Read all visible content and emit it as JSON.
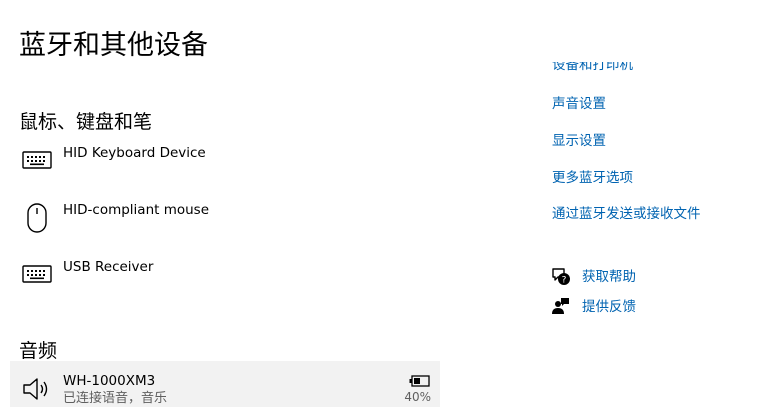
{
  "page": {
    "title": "蓝牙和其他设备"
  },
  "sections": {
    "input": {
      "title": "鼠标、键盘和笔",
      "devices": [
        {
          "name": "HID Keyboard Device",
          "icon": "keyboard-icon"
        },
        {
          "name": "HID-compliant mouse",
          "icon": "mouse-icon"
        },
        {
          "name": "USB Receiver",
          "icon": "keyboard-icon"
        }
      ]
    },
    "audio": {
      "title": "音频",
      "devices": [
        {
          "name": "WH-1000XM3",
          "status": "已连接语音，音乐",
          "battery": "40%",
          "battery_level": 0.4,
          "icon": "speaker-icon"
        }
      ]
    }
  },
  "related_links": [
    {
      "label": "设备和打印机"
    },
    {
      "label": "声音设置"
    },
    {
      "label": "显示设置"
    },
    {
      "label": "更多蓝牙选项"
    },
    {
      "label": "通过蓝牙发送或接收文件"
    }
  ],
  "help": {
    "get_help": {
      "label": "获取帮助",
      "icon": "help-chat-icon"
    },
    "feedback": {
      "label": "提供反馈",
      "icon": "feedback-person-icon"
    }
  },
  "colors": {
    "link": "#0063b1",
    "selected_row": "#f2f2f2",
    "secondary_text": "#5f5f5f"
  }
}
